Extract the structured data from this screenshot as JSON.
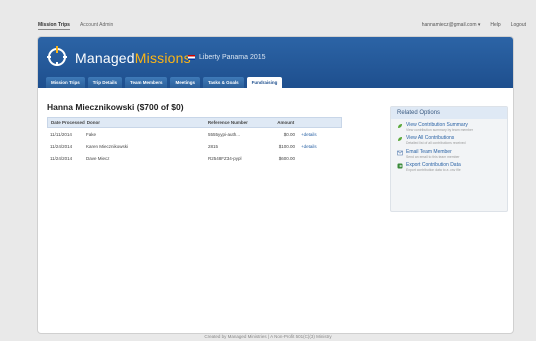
{
  "topnav": {
    "mission_trips": "Mission Trips",
    "account_admin": "Account Admin",
    "user_email": "hannamiecz@gmail.com ▾",
    "help": "Help",
    "logout": "Logout"
  },
  "brand": {
    "part1": "Managed",
    "part2": "Missions"
  },
  "trip_name": "Liberty Panama 2015",
  "tabs": [
    {
      "label": "Mission Trips"
    },
    {
      "label": "Trip Details"
    },
    {
      "label": "Team Members"
    },
    {
      "label": "Meetings"
    },
    {
      "label": "Tasks & Goals"
    },
    {
      "label": "Fundraising"
    }
  ],
  "page_title": "Hanna Miecznikowski ($700 of $0)",
  "table": {
    "headers": [
      "Date Processed",
      "Donor",
      "Reference Number",
      "Amount"
    ],
    "rows": [
      {
        "date": "11/11/2014",
        "donor": "Fake",
        "ref": "5555yypi-auth...",
        "amount": "$0.00",
        "link": "+details"
      },
      {
        "date": "11/24/2014",
        "donor": "Karen Miecznikowski",
        "ref": "2815",
        "amount": "$100.00",
        "link": "+details"
      },
      {
        "date": "11/24/2014",
        "donor": "Dave Miecz",
        "ref": "R2548FZ34-pypl",
        "amount": "$600.00",
        "link": ""
      }
    ]
  },
  "sidebar": {
    "title": "Related Options",
    "options": [
      {
        "label": "View Contribution Summary",
        "desc": "View contribution summary by team member",
        "icon": "leaf-icon"
      },
      {
        "label": "View All Contributions",
        "desc": "Detailed list of all contributions received",
        "icon": "leaf-icon"
      },
      {
        "label": "Email Team Member",
        "desc": "Send an email to this team member",
        "icon": "mail-icon"
      },
      {
        "label": "Export Contribution Data",
        "desc": "Export contribution data to a .csv file",
        "icon": "export-icon"
      }
    ]
  },
  "footer": "Created by Managed Ministries | A Non-Profit 501(C)(3) Ministry",
  "colors": {
    "banner": "#1e4f8e",
    "accent": "#fdb515",
    "link": "#2c64a6"
  }
}
